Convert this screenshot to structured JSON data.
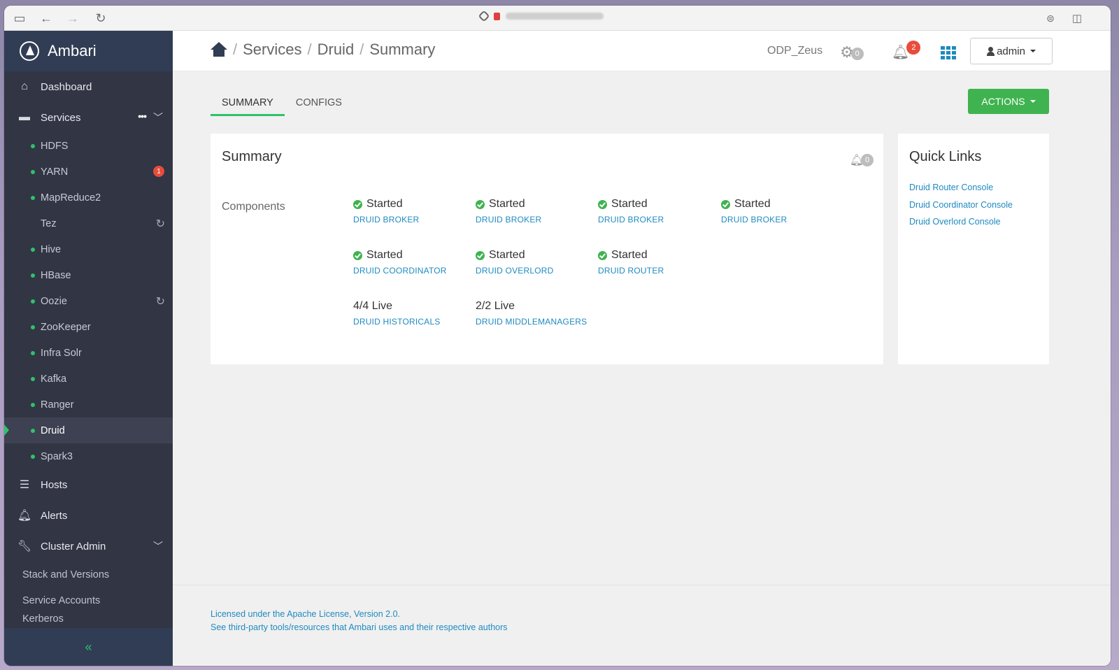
{
  "browser": {
    "sidebar_toggle_icon": "sidebar-icon",
    "back_icon": "←",
    "forward_icon": "→",
    "reload_icon": "↻",
    "right_icons": [
      "extensions-icon",
      "split-view-icon"
    ]
  },
  "brand": {
    "name": "Ambari"
  },
  "sidebar": {
    "dashboard": "Dashboard",
    "services": "Services",
    "services_more": "•••",
    "service_items": [
      {
        "label": "HDFS",
        "dot": true
      },
      {
        "label": "YARN",
        "dot": true,
        "badge": "1"
      },
      {
        "label": "MapReduce2",
        "dot": true
      },
      {
        "label": "Tez",
        "dot": false,
        "refresh": true
      },
      {
        "label": "Hive",
        "dot": true
      },
      {
        "label": "HBase",
        "dot": true
      },
      {
        "label": "Oozie",
        "dot": true,
        "refresh": true
      },
      {
        "label": "ZooKeeper",
        "dot": true
      },
      {
        "label": "Infra Solr",
        "dot": true
      },
      {
        "label": "Kafka",
        "dot": true
      },
      {
        "label": "Ranger",
        "dot": true
      },
      {
        "label": "Druid",
        "dot": true,
        "active": true
      },
      {
        "label": "Spark3",
        "dot": true
      }
    ],
    "hosts": "Hosts",
    "alerts": "Alerts",
    "cluster_admin": "Cluster Admin",
    "cluster_admin_items": [
      "Stack and Versions",
      "Service Accounts",
      "Kerberos"
    ],
    "collapse_icon": "«"
  },
  "header": {
    "breadcrumb": [
      "Services",
      "Druid",
      "Summary"
    ],
    "cluster_name": "ODP_Zeus",
    "ops_count": "0",
    "alerts_count": "2",
    "user": "admin"
  },
  "tabs": [
    "SUMMARY",
    "CONFIGS"
  ],
  "actions_label": "ACTIONS",
  "summary": {
    "title": "Summary",
    "alert_count": "0",
    "components_label": "Components",
    "components": [
      {
        "state": "Started",
        "name": "DRUID BROKER"
      },
      {
        "state": "Started",
        "name": "DRUID BROKER"
      },
      {
        "state": "Started",
        "name": "DRUID BROKER"
      },
      {
        "state": "Started",
        "name": "DRUID BROKER"
      },
      {
        "state": "Started",
        "name": "DRUID COORDINATOR"
      },
      {
        "state": "Started",
        "name": "DRUID OVERLORD"
      },
      {
        "state": "Started",
        "name": "DRUID ROUTER"
      },
      {
        "state": "4/4 Live",
        "name": "DRUID HISTORICALS"
      },
      {
        "state": "2/2 Live",
        "name": "DRUID MIDDLEMANAGERS"
      }
    ]
  },
  "quick_links": {
    "title": "Quick Links",
    "items": [
      "Druid Router Console",
      "Druid Coordinator Console",
      "Druid Overlord Console"
    ]
  },
  "footer": {
    "license": "Licensed under the Apache License, Version 2.0.",
    "third_party": "See third-party tools/resources that Ambari uses and their respective authors"
  }
}
